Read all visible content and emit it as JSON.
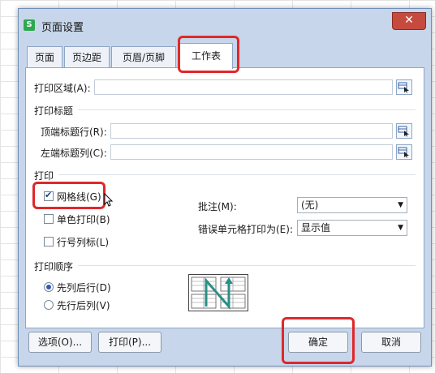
{
  "dialog": {
    "title": "页面设置",
    "app_icon": "S",
    "close": "✕"
  },
  "tabs": [
    {
      "label": "页面"
    },
    {
      "label": "页边距"
    },
    {
      "label": "页眉/页脚"
    },
    {
      "label": "工作表"
    }
  ],
  "print_area": {
    "label": "打印区域(A):",
    "value": ""
  },
  "print_titles": {
    "section": "打印标题",
    "top_rows_label": "顶端标题行(R):",
    "top_rows_value": "",
    "left_cols_label": "左端标题列(C):",
    "left_cols_value": ""
  },
  "print": {
    "section": "打印",
    "gridlines": "网格线(G)",
    "mono": "单色打印(B)",
    "row_col_headers": "行号列标(L)",
    "comments_label": "批注(M):",
    "comments_value": "(无)",
    "errors_label": "错误单元格打印为(E):",
    "errors_value": "显示值"
  },
  "order": {
    "section": "打印顺序",
    "down_then_over": "先列后行(D)",
    "over_then_down": "先行后列(V)"
  },
  "buttons": {
    "options": "选项(O)...",
    "print": "打印(P)...",
    "ok": "确定",
    "cancel": "取消"
  },
  "colors": {
    "highlight": "#e0282a",
    "dialog_bg": "#c7d6ea",
    "accent": "#2d5bb5"
  }
}
